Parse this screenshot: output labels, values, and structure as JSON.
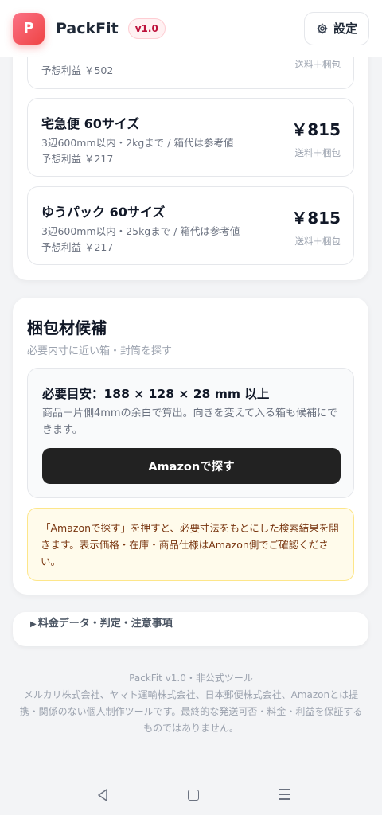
{
  "header": {
    "logo_letter": "P",
    "app_name": "PackFit",
    "version": "v1.0",
    "settings_label": "設定"
  },
  "shipping": {
    "partial_item": {
      "profit": "予想利益 ￥502",
      "price_note": "送料＋梱包"
    },
    "items": [
      {
        "name": "宅急便 60サイズ",
        "spec": "3辺600mm以内・2kgまで / 箱代は参考値",
        "profit": "予想利益 ￥217",
        "price": "￥815",
        "price_note": "送料＋梱包"
      },
      {
        "name": "ゆうパック 60サイズ",
        "spec": "3辺600mm以内・25kgまで / 箱代は参考値",
        "profit": "予想利益 ￥217",
        "price": "￥815",
        "price_note": "送料＋梱包"
      }
    ]
  },
  "packing": {
    "title": "梱包材候補",
    "subtitle": "必要内寸に近い箱・封筒を探す",
    "requirement_title": "必要目安：188 × 128 × 28 mm 以上",
    "requirement_desc": "商品＋片側4mmの余白で算出。向きを変えて入る箱も候補にできます。",
    "amazon_button": "Amazonで探す",
    "notice": "「Amazonで探す」を押すと、必要寸法をもとにした検索結果を開きます。表示価格・在庫・商品仕様はAmazon側でご確認ください。"
  },
  "details": {
    "summary_label": "料金データ・判定・注意事項"
  },
  "footer": {
    "line1": "PackFit v1.0・非公式ツール",
    "disclaimer": "メルカリ株式会社、ヤマト運輸株式会社、日本郵便株式会社、Amazonとは提携・関係のない個人制作ツールです。最終的な発送可否・料金・利益を保証するものではありません。"
  },
  "icons": {
    "settings": "gear-icon",
    "details_toggle": "triangle-right-icon",
    "nav_back": "back-triangle-icon",
    "nav_home": "home-square-icon",
    "nav_menu": "menu-lines-icon"
  },
  "colors": {
    "accent": "#ef4444",
    "button_dark": "#222222",
    "notice_bg": "#fffbeb",
    "notice_border": "#fde68a"
  }
}
